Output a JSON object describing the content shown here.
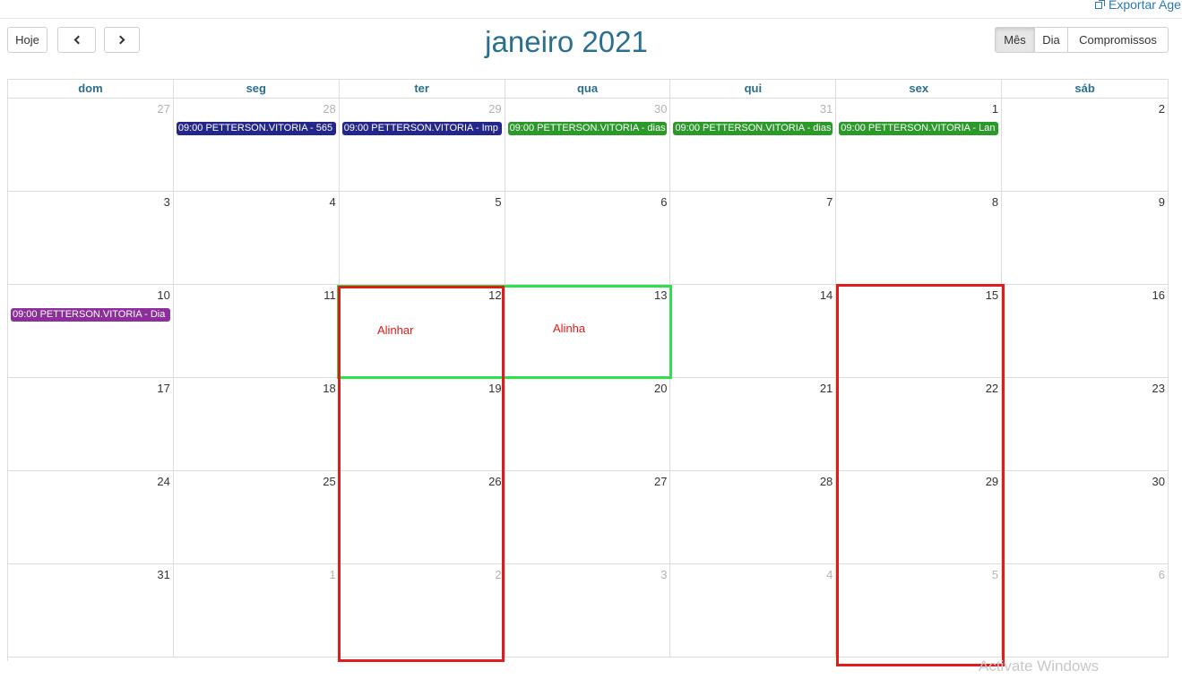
{
  "export_link": {
    "label": "Exportar Age"
  },
  "toolbar": {
    "today_label": "Hoje"
  },
  "calendar_title": "janeiro 2021",
  "views": {
    "month": "Mês",
    "day": "Dia",
    "agenda": "Compromissos"
  },
  "weekdays": [
    "dom",
    "seg",
    "ter",
    "qua",
    "qui",
    "sex",
    "sáb"
  ],
  "weeks": [
    [
      "27",
      "28",
      "29",
      "30",
      "31",
      "1",
      "2"
    ],
    [
      "3",
      "4",
      "5",
      "6",
      "7",
      "8",
      "9"
    ],
    [
      "10",
      "11",
      "12",
      "13",
      "14",
      "15",
      "16"
    ],
    [
      "17",
      "18",
      "19",
      "20",
      "21",
      "22",
      "23"
    ],
    [
      "24",
      "25",
      "26",
      "27",
      "28",
      "29",
      "30"
    ],
    [
      "31",
      "1",
      "2",
      "3",
      "4",
      "5",
      "6"
    ]
  ],
  "events": [
    {
      "label": "09:00 PETTERSON.VITORIA - 565",
      "color": "#24278a"
    },
    {
      "label": "09:00 PETTERSON.VITORIA - Imp",
      "color": "#24278a"
    },
    {
      "label": "09:00 PETTERSON.VITORIA - dias",
      "color": "#2b9a2b"
    },
    {
      "label": "09:00 PETTERSON.VITORIA - dias",
      "color": "#2b9a2b"
    },
    {
      "label": "09:00 PETTERSON.VITORIA - Lan",
      "color": "#2b9a2b"
    },
    {
      "label": "09:00 PETTERSON.VITORIA - Dia",
      "color": "#8d2f9a"
    }
  ],
  "annotations": {
    "note_1": "Alinhar",
    "note_2": "Alinha"
  },
  "watermark": "Activate Windows"
}
